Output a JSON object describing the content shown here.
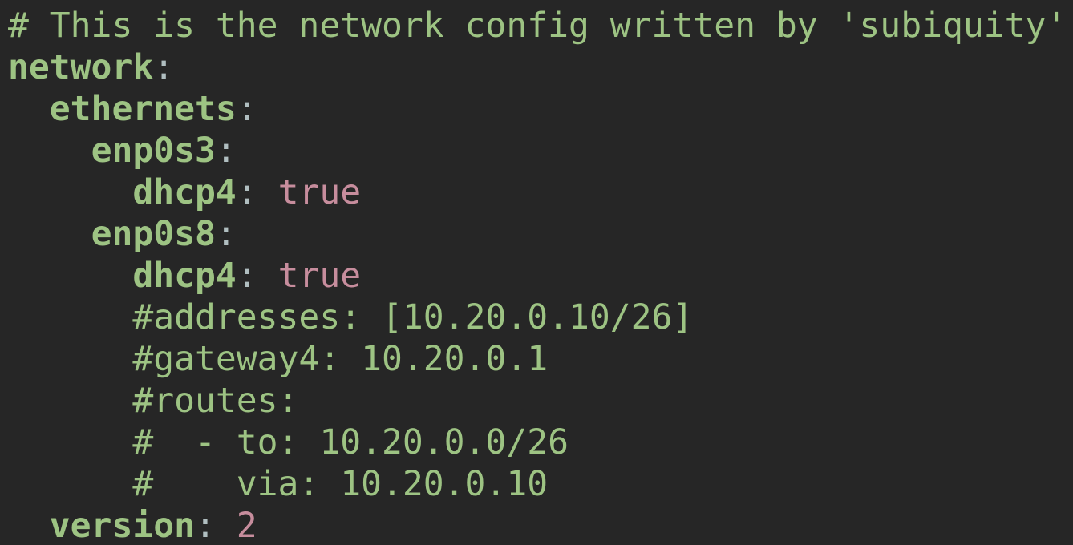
{
  "lines": {
    "l0": "# This is the network config written by 'subiquity'",
    "l1_key": "network",
    "l2_indent": "  ",
    "l2_key": "ethernets",
    "l3_indent": "    ",
    "l3_key": "enp0s3",
    "l4_indent": "      ",
    "l4_key": "dhcp4",
    "l4_val": "true",
    "l5_indent": "    ",
    "l5_key": "enp0s8",
    "l6_indent": "      ",
    "l6_key": "dhcp4",
    "l6_val": "true",
    "l7": "      #addresses: [10.20.0.10/26]",
    "l8": "      #gateway4: 10.20.0.1",
    "l9": "      #routes:",
    "l10": "      #  - to: 10.20.0.0/26",
    "l11": "      #    via: 10.20.0.10",
    "l12_indent": "  ",
    "l12_key": "version",
    "l12_val": "2"
  },
  "colors": {
    "background": "#262626",
    "key": "#9dc383",
    "comment": "#9dc383",
    "scalar": "#c78d9d",
    "punctuation": "#b0bec0"
  }
}
